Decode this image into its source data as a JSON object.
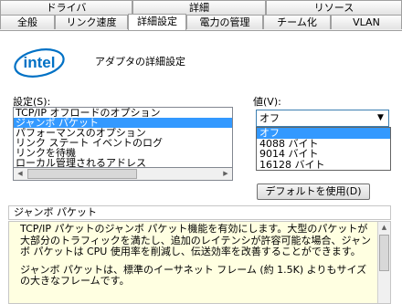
{
  "tabs_row1": [
    {
      "label": "ドライバ"
    },
    {
      "label": "詳細"
    },
    {
      "label": "リソース"
    }
  ],
  "tabs_row2": [
    {
      "label": "全般"
    },
    {
      "label": "リンク速度"
    },
    {
      "label": "詳細設定",
      "active": true
    },
    {
      "label": "電力の管理"
    },
    {
      "label": "チーム化"
    },
    {
      "label": "VLAN"
    }
  ],
  "logo": {
    "text": "intel",
    "color": "#0071c5"
  },
  "adapter_title": "アダプタの詳細設定",
  "settings": {
    "label": "設定(S):",
    "items": [
      {
        "label": "TCP/IP オフロードのオプション",
        "selected": false
      },
      {
        "label": "ジャンボ パケット",
        "selected": true
      },
      {
        "label": "パフォーマンスのオプション",
        "selected": false
      },
      {
        "label": "リンク ステート イベントのログ",
        "selected": false
      },
      {
        "label": "リンクを待機",
        "selected": false
      },
      {
        "label": "ローカル管理されるアドレス",
        "selected": false
      }
    ],
    "scroll_left_icon": "arrow-left",
    "scroll_right_icon": "arrow-right"
  },
  "value": {
    "label": "値(V):",
    "selected": "オフ",
    "options": [
      {
        "label": "オフ",
        "selected": true
      },
      {
        "label": "4088 バイト",
        "selected": false
      },
      {
        "label": "9014 バイト",
        "selected": false
      },
      {
        "label": "16128 バイト",
        "selected": false
      }
    ]
  },
  "default_button": "デフォルトを使用(D)",
  "description": {
    "title": "ジャンボ パケット",
    "paragraph1": "TCP/IP パケットのジャンボ パケット機能を有効にします。大型のパケットが大部分のトラフィックを満たし、追加のレイテンシが許容可能な場合、ジャンボ パケットは CPU 使用率を削減し、伝送効率を改善することができます。",
    "paragraph2": "ジャンボ パケットは、標準のイーサネット フレーム (約 1.5K) よりもサイズの大きなフレームです。"
  },
  "colors": {
    "selection": "#3399ff",
    "description_bg": "#ffffe1",
    "intel_blue": "#0071c5"
  }
}
